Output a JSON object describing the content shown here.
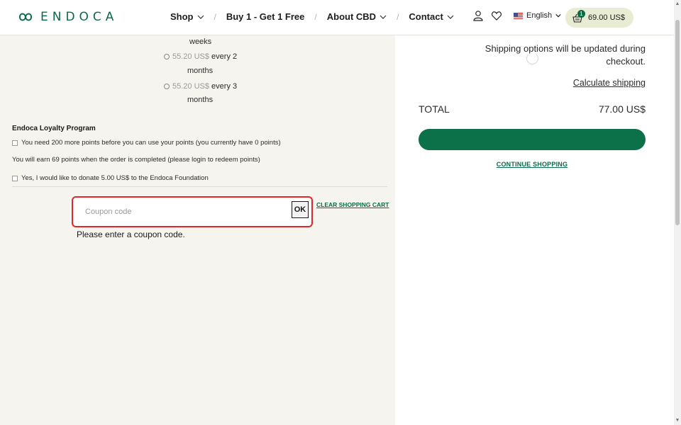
{
  "header": {
    "logo_text": "ENDOCA",
    "nav": [
      {
        "label": "Shop",
        "has_dropdown": true
      },
      {
        "label": "Buy 1 - Get 1 Free",
        "has_dropdown": false
      },
      {
        "label": "About CBD",
        "has_dropdown": true
      },
      {
        "label": "Contact",
        "has_dropdown": true
      }
    ],
    "separator": "/",
    "language": "English",
    "cart": {
      "count": "1",
      "total": "69.00 US$"
    }
  },
  "subscription": {
    "partial_label": "weeks",
    "options": [
      {
        "price": "55.20 US$",
        "every": "every 2",
        "unit": "months"
      },
      {
        "price": "55.20 US$",
        "every": "every 3",
        "unit": "months"
      }
    ]
  },
  "loyalty": {
    "title": "Endoca Loyalty Program",
    "points_needed": "You need 200 more points before you can use your points (you currently have 0 points)",
    "points_earn": "You will earn 69 points when the order is completed (please login to redeem points)",
    "donate": "Yes, I would like to donate 5.00 US$ to the Endoca Foundation"
  },
  "coupon": {
    "placeholder": "Coupon code",
    "ok_label": "OK",
    "clear_cart": "CLEAR SHOPPING CART",
    "message": "Please enter a coupon code."
  },
  "summary": {
    "shipping_note": "Shipping options will be updated during checkout.",
    "calc_shipping": "Calculate shipping",
    "total_label": "TOTAL",
    "total_value": "77.00 US$",
    "continue": "CONTINUE SHOPPING"
  },
  "colors": {
    "brand_green": "#0c7049",
    "highlight_red": "#e3262a",
    "background": "#f5f4ef"
  }
}
